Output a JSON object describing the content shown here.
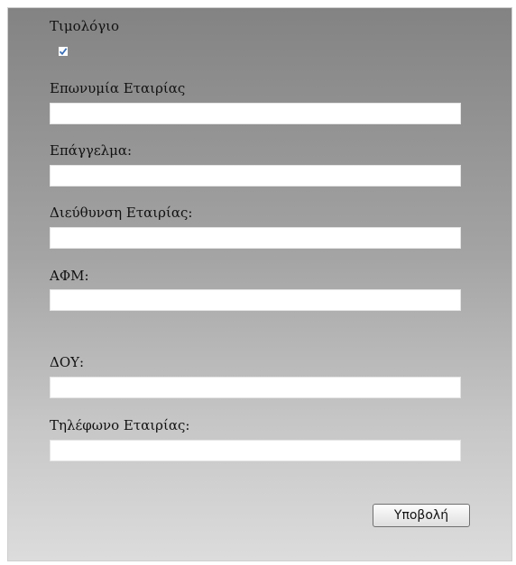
{
  "form": {
    "invoice_label": "Τιμολόγιο",
    "invoice_checked": true,
    "fields": [
      {
        "label": "Επωνυμία Εταιρίας",
        "value": ""
      },
      {
        "label": "Επάγγελμα:",
        "value": ""
      },
      {
        "label": "Διεύθυνση Εταιρίας:",
        "value": ""
      },
      {
        "label": "ΑΦΜ:",
        "value": ""
      },
      {
        "label": "ΔΟΥ:",
        "value": ""
      },
      {
        "label": "Τηλέφωνο Εταιρίας:",
        "value": ""
      }
    ],
    "submit_label": "Υποβολή"
  }
}
